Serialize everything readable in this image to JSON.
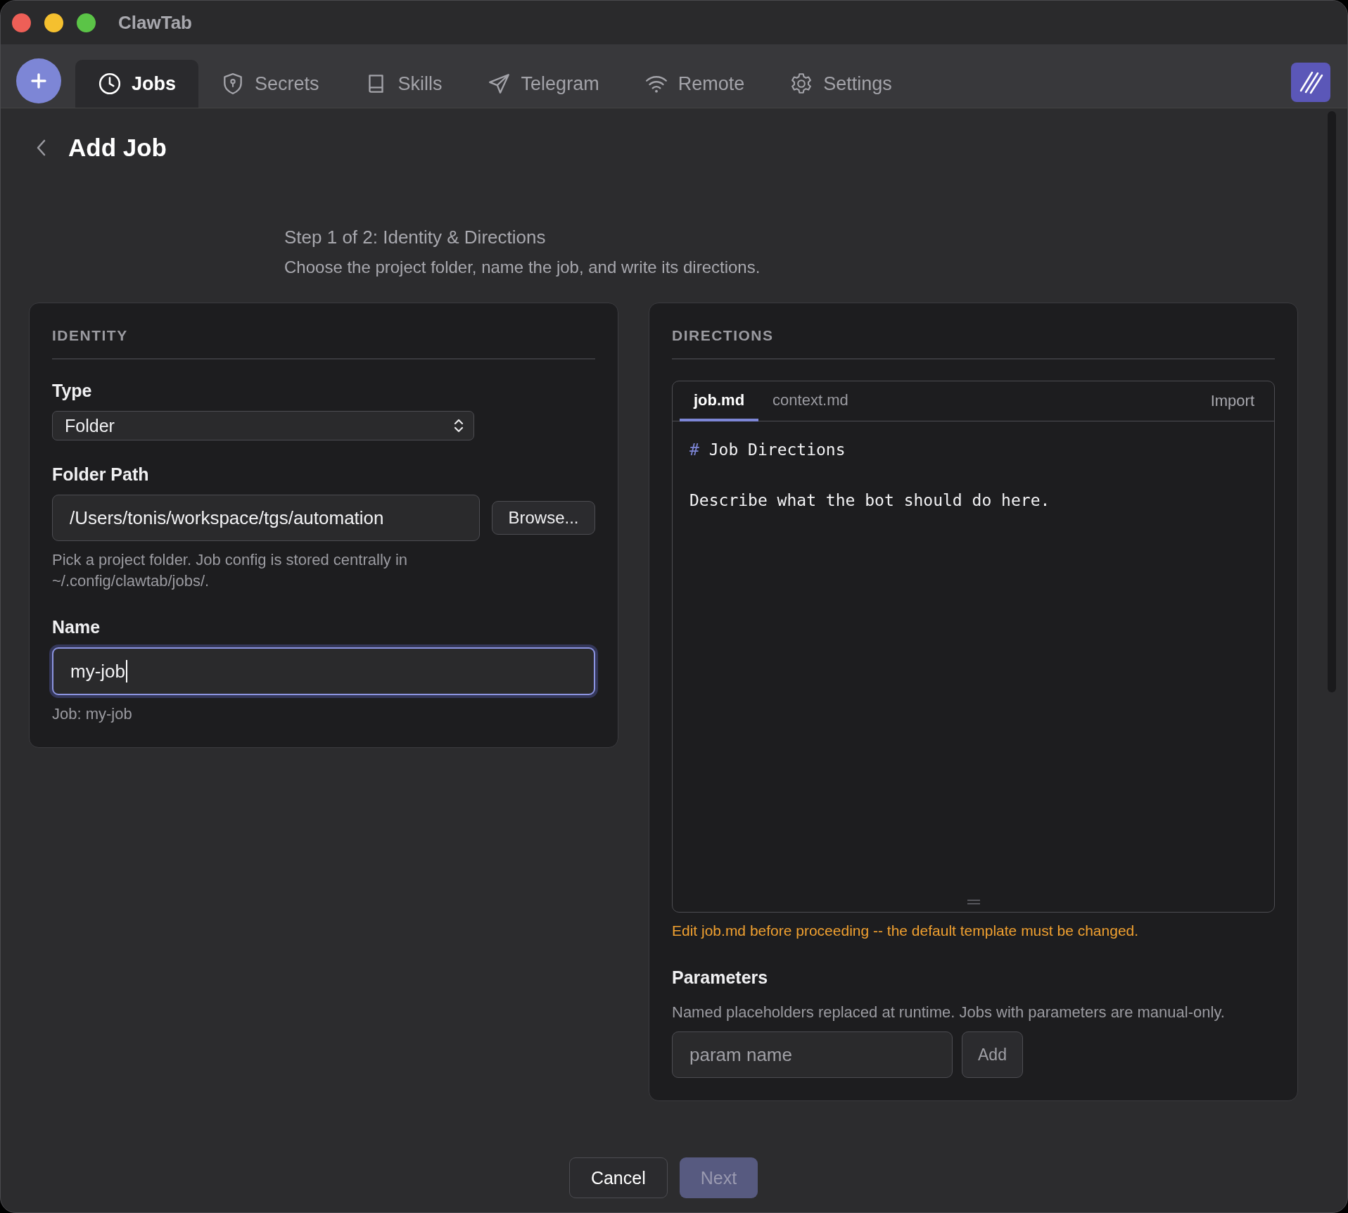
{
  "window": {
    "title": "ClawTab"
  },
  "nav": {
    "tabs": [
      {
        "label": "Jobs",
        "kind": "clock",
        "selected": true
      },
      {
        "label": "Secrets",
        "kind": "shield",
        "selected": false
      },
      {
        "label": "Skills",
        "kind": "book",
        "selected": false
      },
      {
        "label": "Telegram",
        "kind": "send",
        "selected": false
      },
      {
        "label": "Remote",
        "kind": "wifi",
        "selected": false
      },
      {
        "label": "Settings",
        "kind": "gear",
        "selected": false
      }
    ]
  },
  "page": {
    "title": "Add Job",
    "step_title": "Step 1 of 2: Identity & Directions",
    "step_subtitle": "Choose the project folder, name the job, and write its directions."
  },
  "identity": {
    "heading": "IDENTITY",
    "type": {
      "label": "Type",
      "value": "Folder"
    },
    "folder_path": {
      "label": "Folder Path",
      "value": "/Users/tonis/workspace/tgs/automation",
      "button": "Browse...",
      "hint": "Pick a project folder. Job config is stored centrally in ~/.config/clawtab/jobs/."
    },
    "name": {
      "label": "Name",
      "value": "my-job",
      "focused": true,
      "hint": "Job: my-job"
    }
  },
  "directions": {
    "heading": "DIRECTIONS",
    "tabs": [
      {
        "label": "job.md",
        "selected": true
      },
      {
        "label": "context.md",
        "selected": false
      }
    ],
    "import_button": "Import",
    "lines": [
      {
        "kind": "heading",
        "marker": "#",
        "text": "Job Directions"
      },
      {
        "kind": "blank"
      },
      {
        "kind": "text",
        "text": "Describe what the bot should do here."
      }
    ],
    "warning": "Edit job.md before proceeding -- the default template must be changed.",
    "parameters": {
      "label": "Parameters",
      "hint": "Named placeholders replaced at runtime. Jobs with parameters are manual-only.",
      "placeholder": "param name",
      "button": "Add"
    }
  },
  "footer": {
    "buttons": [
      {
        "label": "Cancel",
        "kind": "secondary",
        "disabled": false
      },
      {
        "label": "Next",
        "kind": "primary",
        "disabled": true
      }
    ]
  }
}
